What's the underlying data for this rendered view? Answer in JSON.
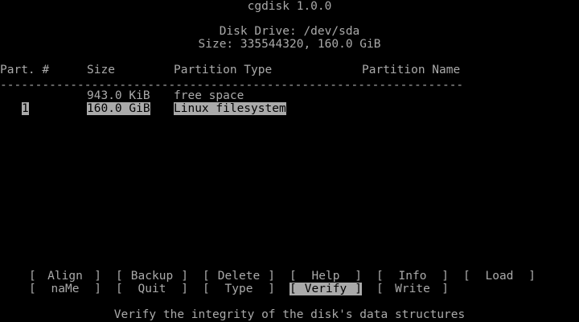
{
  "header": {
    "app_title": "cgdisk 1.0.0",
    "disk_drive": "Disk Drive: /dev/sda",
    "size_line": "Size: 335544320, 160.0 GiB"
  },
  "table": {
    "columns": {
      "part": "Part. #",
      "size": "Size",
      "type": "Partition Type",
      "name": "Partition Name"
    },
    "separator": "----------------------------------------------------------------------------------------------------",
    "rows": [
      {
        "part": "",
        "size": "943.0 KiB",
        "type": "free space",
        "name": ""
      },
      {
        "part": "1",
        "size": "160.0 GiB",
        "type": "Linux filesystem",
        "name": ""
      }
    ]
  },
  "menu": {
    "row1": [
      "Align",
      "Backup",
      "Delete",
      "Help",
      "Info",
      "Load"
    ],
    "row2": [
      "naMe",
      "Quit",
      "Type",
      "Verify",
      "Write"
    ],
    "selected": "Verify"
  },
  "status": {
    "description": "Verify the integrity of the disk's data structures"
  },
  "colors": {
    "background": "#000000",
    "text": "#aaaaaa",
    "highlight_bg": "#aaaaaa",
    "highlight_fg": "#000000"
  }
}
